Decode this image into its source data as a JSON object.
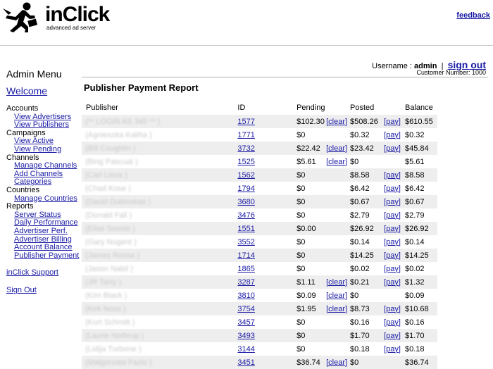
{
  "header": {
    "logo_text": "inClick",
    "logo_tagline": "advanced ad server",
    "feedback": "feedback"
  },
  "user": {
    "username_label": "Username :",
    "username": "admin",
    "separator": "|",
    "signout": "sign out",
    "customer_number": "Customer Number: 1000"
  },
  "sidebar": {
    "title": "Admin Menu",
    "welcome": "Welcome",
    "accounts": {
      "label": "Accounts",
      "items": [
        "View Advertisers",
        "View Publishers"
      ]
    },
    "campaigns": {
      "label": "Campaigns",
      "items": [
        "View Active",
        "View Pending"
      ]
    },
    "channels": {
      "label": "Channels",
      "items": [
        "Manage Channels",
        "Add Channels",
        "Categories"
      ]
    },
    "countries": {
      "label": "Countries",
      "items": [
        "Manage Countries"
      ]
    },
    "reports": {
      "label": "Reports",
      "items": [
        "Server Status",
        "Daily Performance",
        "Advertiser Perf.",
        "Advertiser Billing",
        "Account Balance",
        "Publisher Payment"
      ]
    },
    "support": "inClick Support",
    "signout": "Sign Out"
  },
  "report": {
    "title": "Publisher Payment Report",
    "columns": [
      "Publisher",
      "ID",
      "Pending",
      "Posted",
      "Balance"
    ],
    "clear_label": "[clear]",
    "pay_label": "[pay]",
    "rows": [
      {
        "pub": "(**  LOGIN AS  345 ** )",
        "id": "1577",
        "pending": "$102.30",
        "clear": true,
        "posted": "$508.26",
        "pay": true,
        "balance": "$610.55"
      },
      {
        "pub": "(Agnieszka Kaliha )",
        "id": "1771",
        "pending": "$0",
        "clear": false,
        "posted": "$0.32",
        "pay": true,
        "balance": "$0.32"
      },
      {
        "pub": "(Bill Coughlin )",
        "id": "3732",
        "pending": "$22.42",
        "clear": true,
        "posted": "$23.42",
        "pay": true,
        "balance": "$45.84"
      },
      {
        "pub": "(Bing Pascual )",
        "id": "1525",
        "pending": "$5.61",
        "clear": true,
        "posted": "$0",
        "pay": false,
        "balance": "$5.61"
      },
      {
        "pub": "(Carl Linus )",
        "id": "1562",
        "pending": "$0",
        "clear": false,
        "posted": "$8.58",
        "pay": true,
        "balance": "$8.58"
      },
      {
        "pub": "(Chad Kose )",
        "id": "1794",
        "pending": "$0",
        "clear": false,
        "posted": "$6.42",
        "pay": true,
        "balance": "$6.42"
      },
      {
        "pub": "(David Dubinskas )",
        "id": "3680",
        "pending": "$0",
        "clear": false,
        "posted": "$0.67",
        "pay": true,
        "balance": "$0.67"
      },
      {
        "pub": "(Donald Fall )",
        "id": "3476",
        "pending": "$0",
        "clear": false,
        "posted": "$2.79",
        "pay": true,
        "balance": "$2.79"
      },
      {
        "pub": "(Elise Sosnie )",
        "id": "1551",
        "pending": "$0.00",
        "clear": false,
        "posted": "$26.92",
        "pay": true,
        "balance": "$26.92"
      },
      {
        "pub": "(Gary Nugent )",
        "id": "3552",
        "pending": "$0",
        "clear": false,
        "posted": "$0.14",
        "pay": true,
        "balance": "$0.14"
      },
      {
        "pub": "(James Rosse )",
        "id": "1714",
        "pending": "$0",
        "clear": false,
        "posted": "$14.25",
        "pay": true,
        "balance": "$14.25"
      },
      {
        "pub": "(Jason Nabil )",
        "id": "1865",
        "pending": "$0",
        "clear": false,
        "posted": "$0.02",
        "pay": true,
        "balance": "$0.02"
      },
      {
        "pub": "(JR Tarry )",
        "id": "3287",
        "pending": "$1.11",
        "clear": true,
        "posted": "$0.21",
        "pay": true,
        "balance": "$1.32"
      },
      {
        "pub": "(Kim Black )",
        "id": "3810",
        "pending": "$0.09",
        "clear": true,
        "posted": "$0",
        "pay": false,
        "balance": "$0.09"
      },
      {
        "pub": "(Kirk Noss )",
        "id": "3754",
        "pending": "$1.95",
        "clear": true,
        "posted": "$8.73",
        "pay": true,
        "balance": "$10.68"
      },
      {
        "pub": "(Kurt Schmitt )",
        "id": "3457",
        "pending": "$0",
        "clear": false,
        "posted": "$0.16",
        "pay": true,
        "balance": "$0.16"
      },
      {
        "pub": "(Laurie Nothrup )",
        "id": "3493",
        "pending": "$0",
        "clear": false,
        "posted": "$1.70",
        "pay": true,
        "balance": "$1.70"
      },
      {
        "pub": "(Lidija Turbone )",
        "id": "3144",
        "pending": "$0",
        "clear": false,
        "posted": "$0.18",
        "pay": true,
        "balance": "$0.18"
      },
      {
        "pub": "(Malgorzata Fazio )",
        "id": "3451",
        "pending": "$36.74",
        "clear": true,
        "posted": "$0",
        "pay": false,
        "balance": "$36.74"
      }
    ]
  }
}
